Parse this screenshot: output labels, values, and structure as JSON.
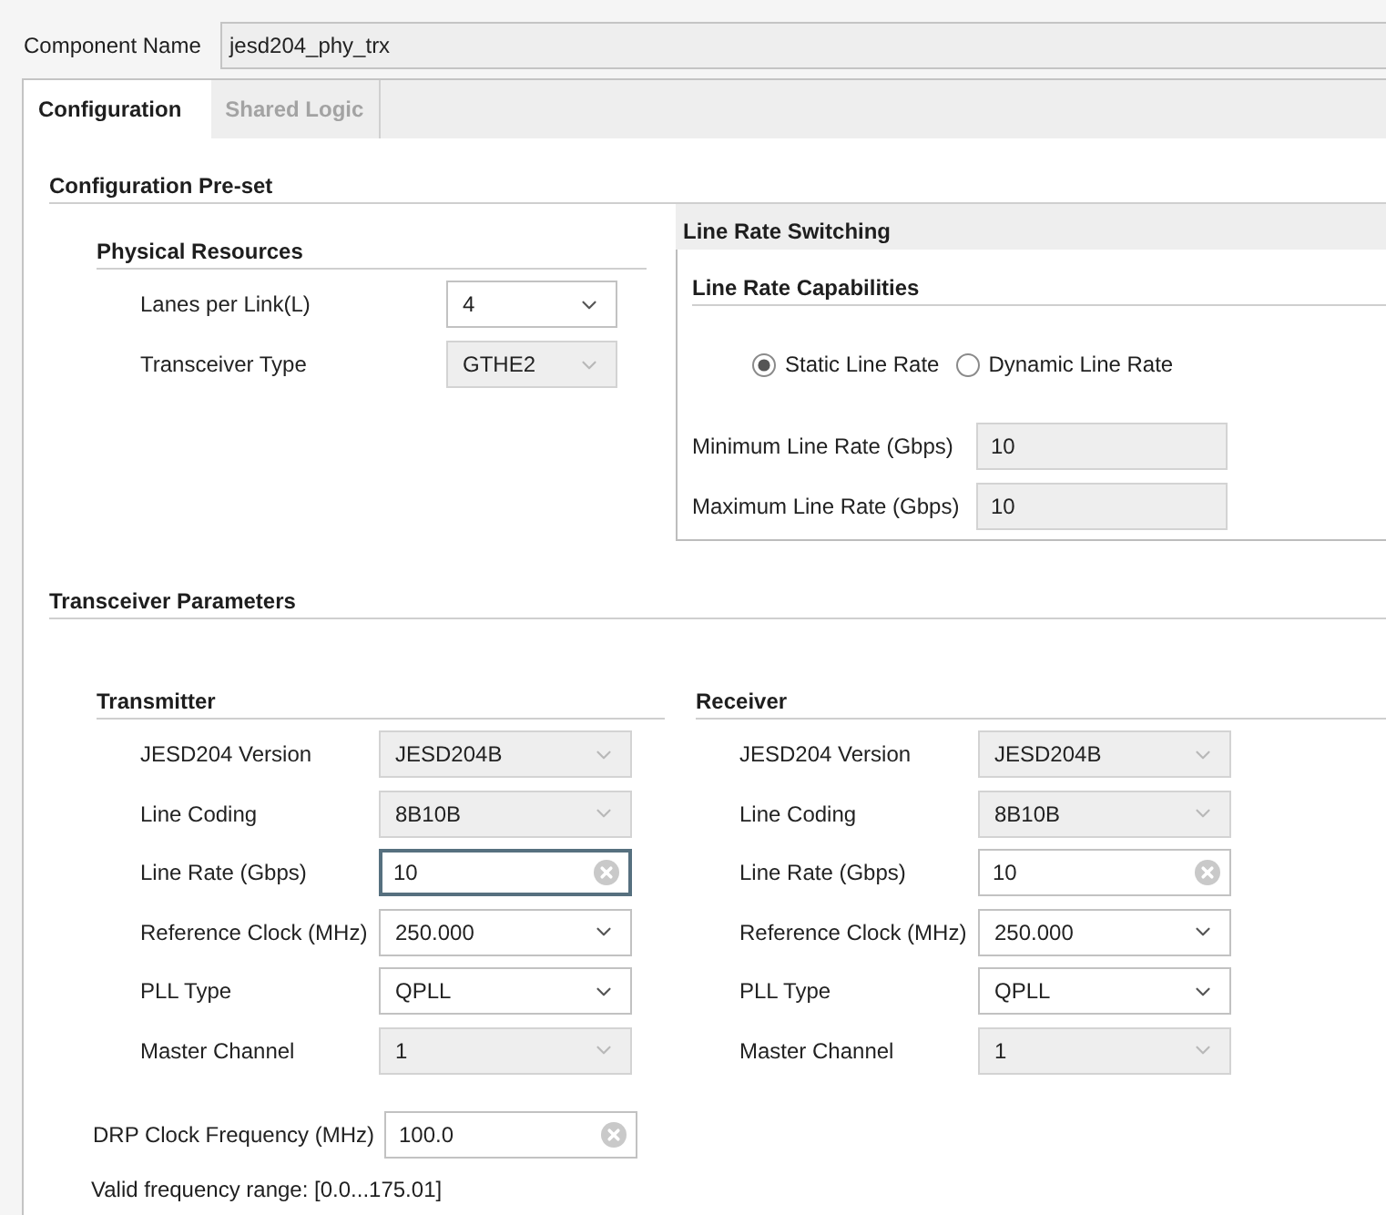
{
  "component_name": {
    "label": "Component Name",
    "value": "jesd204_phy_trx"
  },
  "tabs": [
    {
      "label": "Configuration",
      "selected": true
    },
    {
      "label": "Shared Logic",
      "selected": false
    }
  ],
  "configuration_preset": {
    "title": "Configuration Pre-set",
    "physical_resources": {
      "title": "Physical Resources",
      "fields": [
        {
          "label": "Lanes per Link(L)",
          "kind": "dropdown",
          "value": "4",
          "disabled": false,
          "focused": false
        },
        {
          "label": "Transceiver Type",
          "kind": "dropdown",
          "value": "GTHE2",
          "disabled": true,
          "focused": false
        }
      ]
    },
    "line_rate_switching": {
      "title": "Line Rate Switching",
      "capabilities_title": "Line Rate Capabilities",
      "options": [
        {
          "label": "Static Line Rate",
          "selected": true
        },
        {
          "label": "Dynamic Line Rate",
          "selected": false
        }
      ],
      "fields": [
        {
          "label": "Minimum Line Rate (Gbps)",
          "kind": "entry",
          "value": "10",
          "disabled": true,
          "focused": false
        },
        {
          "label": "Maximum Line Rate (Gbps)",
          "kind": "entry",
          "value": "10",
          "disabled": true,
          "focused": false
        }
      ]
    }
  },
  "transceiver_parameters": {
    "title": "Transceiver Parameters",
    "groups": [
      {
        "title": "Transmitter",
        "fields": [
          {
            "label": "JESD204 Version",
            "kind": "dropdown",
            "value": "JESD204B",
            "disabled": true,
            "focused": false
          },
          {
            "label": "Line Coding",
            "kind": "dropdown",
            "value": "8B10B",
            "disabled": true,
            "focused": false
          },
          {
            "label": "Line Rate (Gbps)",
            "kind": "clearable",
            "value": "10",
            "disabled": false,
            "focused": true
          },
          {
            "label": "Reference Clock (MHz)",
            "kind": "dropdown",
            "value": "250.000",
            "disabled": false,
            "focused": false
          },
          {
            "label": "PLL Type",
            "kind": "dropdown",
            "value": "QPLL",
            "disabled": false,
            "focused": false
          },
          {
            "label": "Master Channel",
            "kind": "dropdown",
            "value": "1",
            "disabled": true,
            "focused": false
          }
        ]
      },
      {
        "title": "Receiver",
        "fields": [
          {
            "label": "JESD204 Version",
            "kind": "dropdown",
            "value": "JESD204B",
            "disabled": true,
            "focused": false
          },
          {
            "label": "Line Coding",
            "kind": "dropdown",
            "value": "8B10B",
            "disabled": true,
            "focused": false
          },
          {
            "label": "Line Rate (Gbps)",
            "kind": "clearable",
            "value": "10",
            "disabled": false,
            "focused": false
          },
          {
            "label": "Reference Clock (MHz)",
            "kind": "dropdown",
            "value": "250.000",
            "disabled": false,
            "focused": false
          },
          {
            "label": "PLL Type",
            "kind": "dropdown",
            "value": "QPLL",
            "disabled": false,
            "focused": false
          },
          {
            "label": "Master Channel",
            "kind": "dropdown",
            "value": "1",
            "disabled": true,
            "focused": false
          }
        ]
      }
    ],
    "drp_clock": {
      "label": "DRP Clock Frequency (MHz)",
      "kind": "clearable",
      "value": "100.0",
      "disabled": false,
      "focused": false
    },
    "valid_range": "Valid frequency range: [0.0...175.01]"
  }
}
